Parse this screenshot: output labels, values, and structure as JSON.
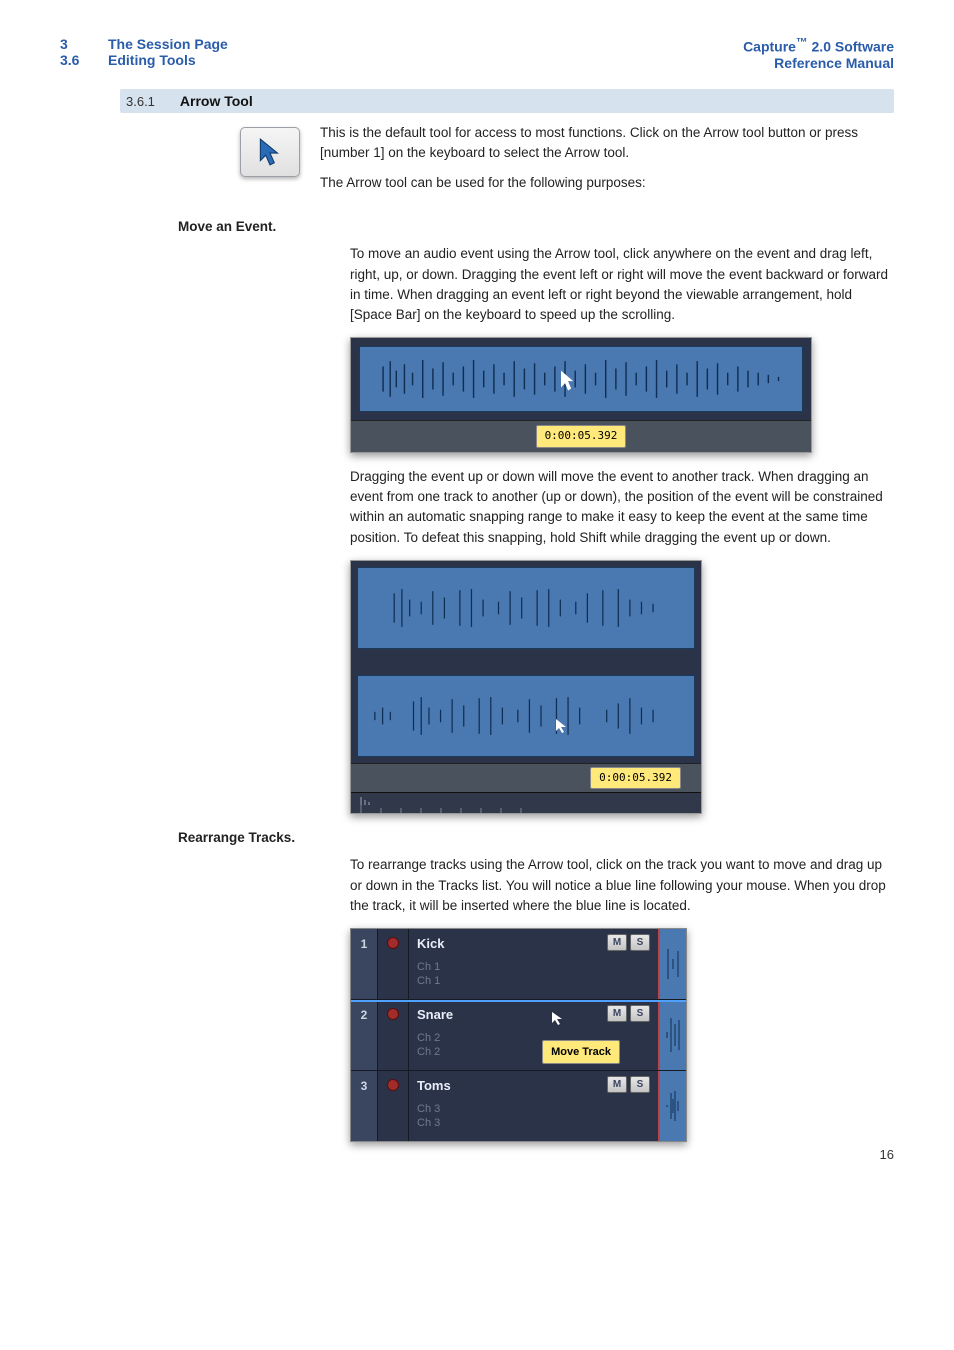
{
  "header": {
    "left": {
      "num1": "3",
      "title1": "The Session Page",
      "num2": "3.6",
      "title2": "Editing Tools"
    },
    "right": {
      "line1a": "Capture",
      "line1b": "™",
      "line1c": " 2.0 Software",
      "line2": "Reference Manual"
    }
  },
  "section": {
    "num": "3.6.1",
    "title": "Arrow Tool"
  },
  "intro": {
    "p1": "This is the default tool for access to most functions. Click on the Arrow tool button or press [number 1] on the keyboard to select the Arrow tool.",
    "p2": "The Arrow tool can be used for the following purposes:"
  },
  "move_event": {
    "heading": "Move an Event.",
    "p1": "To move an audio event using the Arrow tool, click anywhere on the event and drag left, right, up, or down. Dragging the event left or right will move the event backward or forward in time. When dragging an event left or right beyond the viewable arrangement, hold [Space Bar] on the keyboard to speed up the scrolling.",
    "time1": "0:00:05.392",
    "p2": "Dragging the event up or down will move the event to another track. When dragging an event from one track to another (up or down), the position of the event will be constrained within an automatic snapping range to make it easy to keep the event at the same time position. To defeat this snapping, hold Shift while dragging the event up or down.",
    "time2": "0:00:05.392"
  },
  "rearrange": {
    "heading": "Rearrange Tracks.",
    "p1": "To rearrange tracks using the Arrow tool, click on the track you want to move and drag up or down in the Tracks list. You will notice a blue line following your mouse. When you drop the track, it will be inserted where the blue line is located.",
    "move_track_label": "Move Track",
    "tracks": [
      {
        "num": "1",
        "name": "Kick",
        "chA": "Ch 1",
        "chB": "Ch 1"
      },
      {
        "num": "2",
        "name": "Snare",
        "chA": "Ch 2",
        "chB": "Ch 2"
      },
      {
        "num": "3",
        "name": "Toms",
        "chA": "Ch 3",
        "chB": "Ch 3"
      }
    ],
    "ms": {
      "m": "M",
      "s": "S"
    }
  },
  "page_number": "16"
}
